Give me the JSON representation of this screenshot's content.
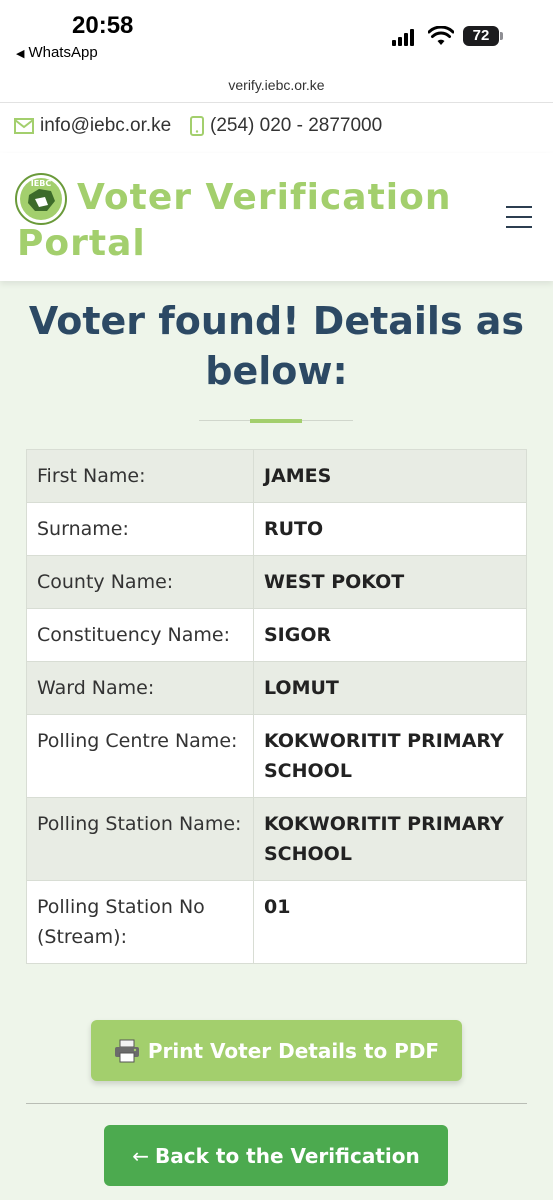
{
  "status_bar": {
    "time": "20:58",
    "back_app": "WhatsApp",
    "battery": "72"
  },
  "browser": {
    "url": "verify.iebc.or.ke"
  },
  "contact": {
    "email": "info@iebc.or.ke",
    "phone": "(254) 020 - 2877000",
    "email_icon": "envelope-icon",
    "phone_icon": "mobile-phone-icon"
  },
  "header": {
    "logo_text": "IEBC",
    "title": "Voter Verification Portal",
    "menu_icon": "hamburger-menu-icon"
  },
  "main": {
    "heading": "Voter found! Details as below:",
    "details": [
      {
        "label": "First Name:",
        "value": "JAMES"
      },
      {
        "label": "Surname:",
        "value": "RUTO"
      },
      {
        "label": "County Name:",
        "value": "WEST POKOT"
      },
      {
        "label": "Constituency Name:",
        "value": "SIGOR"
      },
      {
        "label": "Ward Name:",
        "value": "LOMUT"
      },
      {
        "label": "Polling Centre Name:",
        "value": "KOKWORITIT PRIMARY SCHOOL"
      },
      {
        "label": "Polling Station Name:",
        "value": "KOKWORITIT PRIMARY SCHOOL"
      },
      {
        "label": "Polling Station No (Stream):",
        "value": "01"
      }
    ],
    "print_button": "Print Voter Details to PDF",
    "back_button": "Back to the Verification"
  },
  "colors": {
    "brand_green": "#a3cf6d",
    "button_green": "#4caa4f",
    "heading_blue": "#2c4964"
  }
}
